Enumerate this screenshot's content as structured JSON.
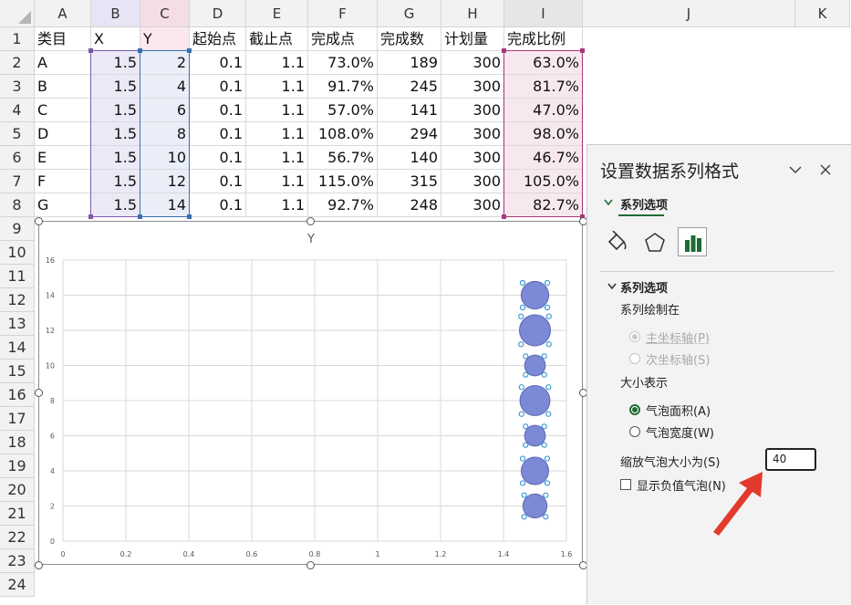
{
  "columns": [
    "A",
    "B",
    "C",
    "D",
    "E",
    "F",
    "G",
    "H",
    "I",
    "J",
    "K"
  ],
  "rows": [
    "1",
    "2",
    "3",
    "4",
    "5",
    "6",
    "7",
    "8",
    "9",
    "10",
    "11",
    "12",
    "13",
    "14",
    "15",
    "16",
    "17",
    "18",
    "19",
    "20",
    "21",
    "22",
    "23",
    "24"
  ],
  "table": {
    "headers": [
      "类目",
      "X",
      "Y",
      "起始点",
      "截止点",
      "完成点",
      "完成数",
      "计划量",
      "完成比例"
    ],
    "rows": [
      [
        "A",
        "1.5",
        "2",
        "0.1",
        "1.1",
        "73.0%",
        "189",
        "300",
        "63.0%"
      ],
      [
        "B",
        "1.5",
        "4",
        "0.1",
        "1.1",
        "91.7%",
        "245",
        "300",
        "81.7%"
      ],
      [
        "C",
        "1.5",
        "6",
        "0.1",
        "1.1",
        "57.0%",
        "141",
        "300",
        "47.0%"
      ],
      [
        "D",
        "1.5",
        "8",
        "0.1",
        "1.1",
        "108.0%",
        "294",
        "300",
        "98.0%"
      ],
      [
        "E",
        "1.5",
        "10",
        "0.1",
        "1.1",
        "56.7%",
        "140",
        "300",
        "46.7%"
      ],
      [
        "F",
        "1.5",
        "12",
        "0.1",
        "1.1",
        "115.0%",
        "315",
        "300",
        "105.0%"
      ],
      [
        "G",
        "1.5",
        "14",
        "0.1",
        "1.1",
        "92.7%",
        "248",
        "300",
        "82.7%"
      ]
    ]
  },
  "chart_data": {
    "type": "scatter",
    "title": "Y",
    "x_ticks": [
      "0",
      "0.2",
      "0.4",
      "0.6",
      "0.8",
      "1",
      "1.2",
      "1.4",
      "1.6"
    ],
    "y_ticks": [
      "0",
      "2",
      "4",
      "6",
      "8",
      "10",
      "12",
      "14",
      "16"
    ],
    "xlim": [
      0,
      1.6
    ],
    "ylim": [
      0,
      16
    ],
    "grid": true,
    "bubble_color": "#7b89d6",
    "points": [
      {
        "x": 1.5,
        "y": 2,
        "size": 63.0
      },
      {
        "x": 1.5,
        "y": 4,
        "size": 81.7
      },
      {
        "x": 1.5,
        "y": 6,
        "size": 47.0
      },
      {
        "x": 1.5,
        "y": 8,
        "size": 98.0
      },
      {
        "x": 1.5,
        "y": 10,
        "size": 46.7
      },
      {
        "x": 1.5,
        "y": 12,
        "size": 105.0
      },
      {
        "x": 1.5,
        "y": 14,
        "size": 82.7
      }
    ]
  },
  "panel": {
    "title": "设置数据系列格式",
    "tab_label": "系列选项",
    "section_label": "系列选项",
    "plot_on_label": "系列绘制在",
    "primary_axis": "主坐标轴(P)",
    "secondary_axis": "次坐标轴(S)",
    "size_represents": "大小表示",
    "bubble_area": "气泡面积(A)",
    "bubble_width": "气泡宽度(W)",
    "scale_label": "缩放气泡大小为(S)",
    "scale_value": "40",
    "negative_label": "显示负值气泡(N)",
    "accent_color": "#1f6b35",
    "arrow_color": "#e23b2e"
  }
}
